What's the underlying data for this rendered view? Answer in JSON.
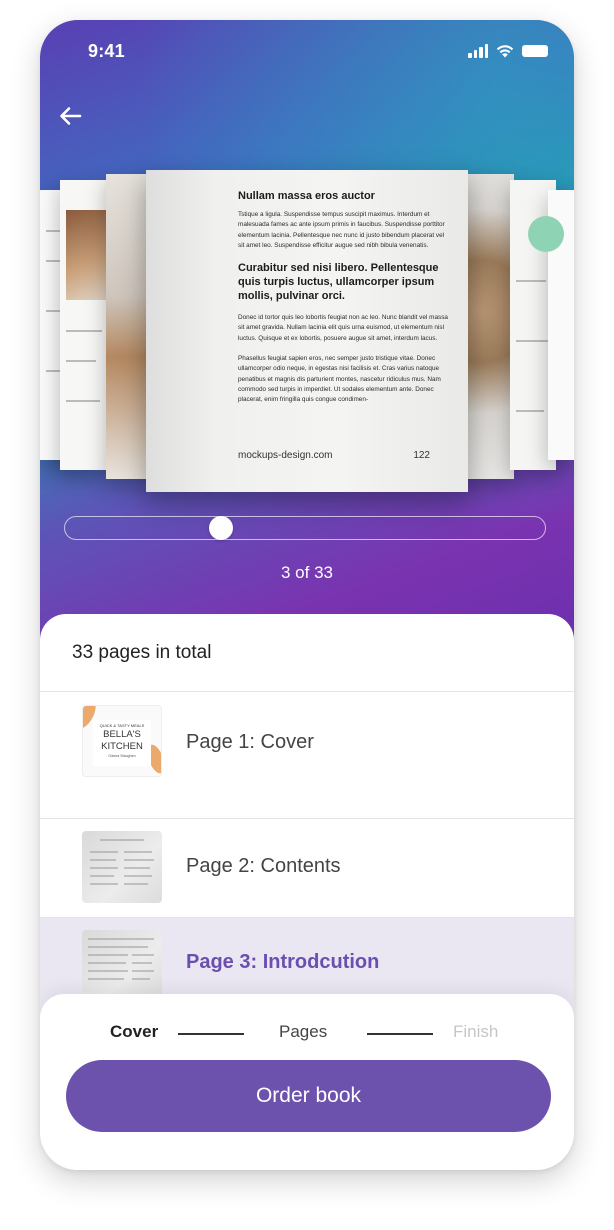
{
  "status_bar": {
    "time": "9:41"
  },
  "book_preview": {
    "heading": "Nullam massa eros auctor",
    "paragraph1": "Tstique a ligula. Suspendisse tempus suscipit maximus. Interdum et malesuada fames ac ante ipsum primis in faucibus. Suspendisse porttitor elementum lacinia. Pellentesque nec nunc id justo bibendum placerat vel sit amet leo. Suspendisse efficitur augue sed nibh bibula venenatis.",
    "subheading": "Curabitur sed nisi libero. Pellentesque quis turpis luctus, ullamcorper ipsum mollis, pulvinar orci.",
    "paragraph2": "Donec id tortor quis leo lobortis feugiat non ac leo. Nunc blandit vel massa sit amet gravida. Nullam lacinia elit quis urna euismod, ut elementum nisl luctus. Quisque et ex lobortis, posuere augue sit amet, interdum lacus.",
    "paragraph3": "Phasellus feugiat sapien eros, nec semper justo tristique vitae. Donec ullamcorper odio neque, in egestas nisi facilisis et. Cras varius natoque penatibus et magnis dis parturient montes, nascetur ridiculus mus. Nam commodo sed turpis in imperdiet. Ut sodales elementum ante. Donec placerat, enim fringilla quis congue condimen-",
    "footer_site": "mockups-design.com",
    "page_number": "122"
  },
  "slider": {
    "current_page": 3,
    "total_pages": 33,
    "label": "3 of 33"
  },
  "pages_panel": {
    "total_label": "33 pages in total",
    "items": [
      {
        "label": "Page 1: Cover",
        "selected": false
      },
      {
        "label": "Page 2: Contents",
        "selected": false
      },
      {
        "label": "Page 3: Introdcution",
        "selected": true
      }
    ],
    "cover_thumb": {
      "line1": "QUICK & TASTY MEALS",
      "line2": "BELLA'S",
      "line3": "KITCHEN",
      "author": "Odena Staughen"
    }
  },
  "steps": {
    "items": [
      {
        "label": "Cover",
        "state": "active"
      },
      {
        "label": "Pages",
        "state": "current"
      },
      {
        "label": "Finish",
        "state": "disabled"
      }
    ]
  },
  "order_button": {
    "label": "Order book"
  },
  "colors": {
    "accent": "#6c51ad",
    "selected_row": "#ebe7f2",
    "selected_text": "#6a4fb0",
    "gradient_top": "#2a8eb5",
    "gradient_bottom": "#7a33b0"
  }
}
